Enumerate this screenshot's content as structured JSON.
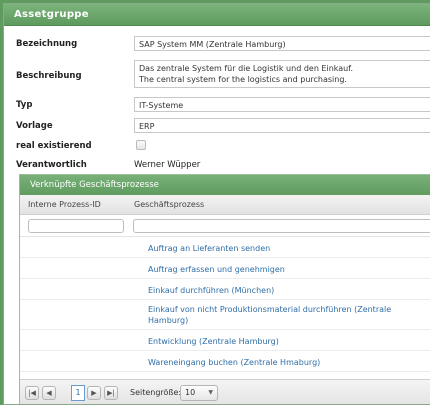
{
  "window": {
    "title": "Assetgruppe"
  },
  "form": {
    "bezeichnung": {
      "label": "Bezeichnung",
      "value": "SAP System MM (Zentrale Hamburg)"
    },
    "beschreibung": {
      "label": "Beschreibung",
      "line1": "Das zentrale System für die Logistik und den Einkauf.",
      "line2": "The central system for the logistics and purchasing."
    },
    "typ": {
      "label": "Typ",
      "value": "IT-Systeme"
    },
    "vorlage": {
      "label": "Vorlage",
      "value": "ERP"
    },
    "real": {
      "label": "real existierend",
      "checked": false
    },
    "verantwortlich": {
      "label": "Verantwortlich",
      "value": "Werner Wüpper"
    }
  },
  "grid": {
    "title": "Verknüpfte Geschäftsprozesse",
    "columns": [
      "Interne Prozess-ID",
      "Geschäftsprozess"
    ],
    "rows": [
      {
        "id": "",
        "process": "Auftrag an Lieferanten senden"
      },
      {
        "id": "",
        "process": "Auftrag erfassen und genehmigen"
      },
      {
        "id": "",
        "process": "Einkauf durchführen (München)"
      },
      {
        "id": "",
        "process": "Einkauf von nicht Produktionsmaterial durchführen (Zentrale Hamburg)"
      },
      {
        "id": "",
        "process": "Entwicklung (Zentrale Hamburg)"
      },
      {
        "id": "",
        "process": "Wareneingang buchen (Zentrale Hmaburg)"
      }
    ],
    "pager": {
      "first": "|◀",
      "prev": "◀",
      "current_page": "1",
      "next": "▶",
      "last": "▶|",
      "page_size_label": "Seitengröße:",
      "page_size": "10"
    }
  }
}
